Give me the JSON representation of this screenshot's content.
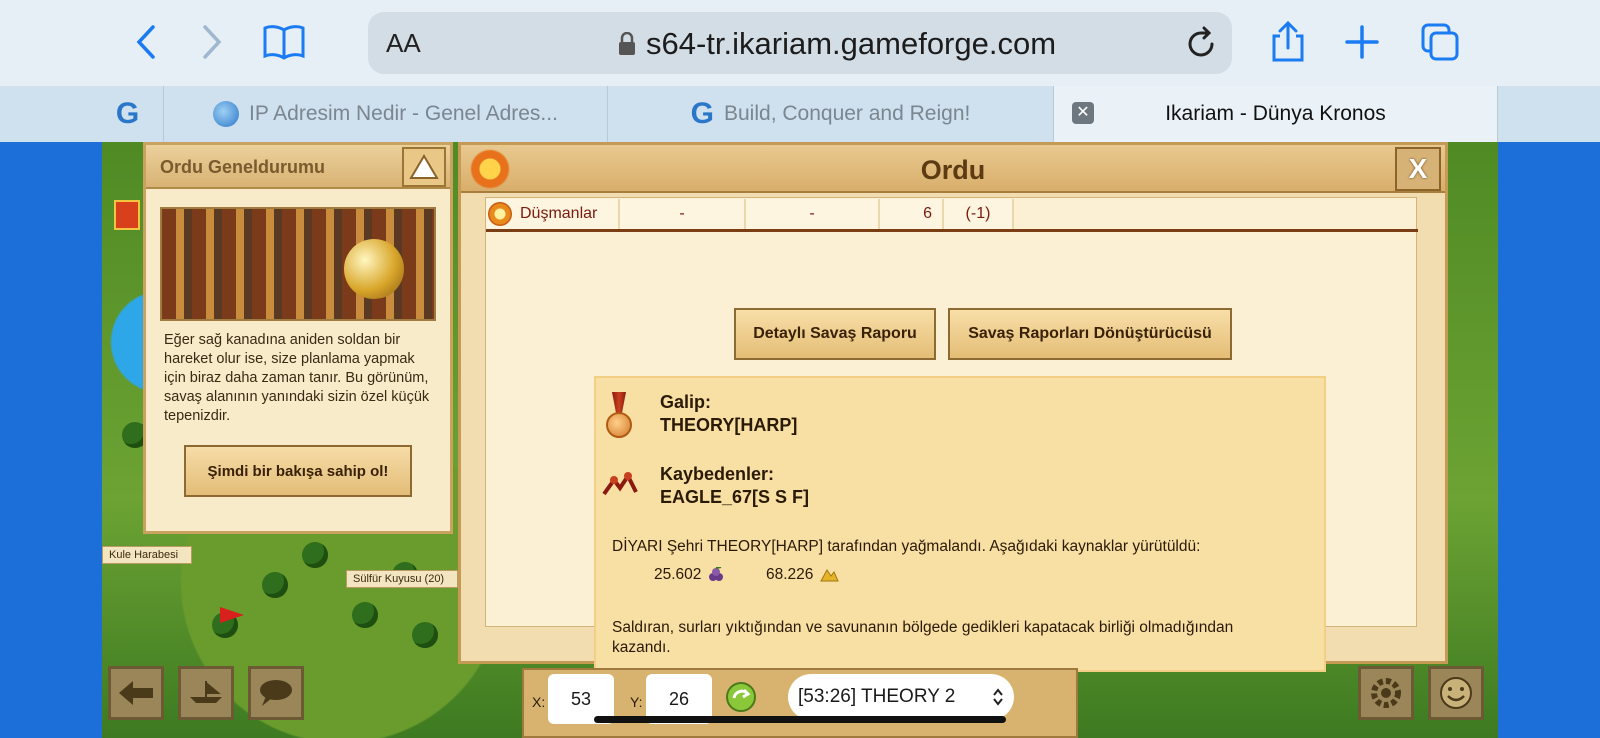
{
  "browser": {
    "address_size_label": "AA",
    "url": "s64-tr.ikariam.gameforge.com",
    "icons": [
      "back-icon",
      "forward-icon",
      "bookmarks-icon",
      "lock-icon",
      "reload-icon",
      "share-icon",
      "plus-icon",
      "tabs-icon"
    ],
    "tabs": [
      {
        "label": ""
      },
      {
        "label": "IP Adresim Nedir - Genel Adres..."
      },
      {
        "label": "Build, Conquer and Reign!"
      },
      {
        "label": "Ikariam - Dünya Kronos"
      }
    ]
  },
  "map": {
    "labels": [
      "Kule Harabesi",
      "Sülfür Kuyusu (20)"
    ]
  },
  "left_panel": {
    "title": "Ordu Geneldurumu",
    "text": "Eğer sağ kanadına aniden soldan bir hareket olur ise, size planlama yapmak için biraz daha zaman tanır. Bu görünüm, savaş alanının yanındaki sizin özel küçük tepenizdir.",
    "button": "Şimdi bir bakışa sahip ol!"
  },
  "main_window": {
    "title": "Ordu",
    "close": "X",
    "enemy_row": {
      "label": "Düşmanlar",
      "cells": [
        "-",
        "-",
        "6",
        "(-1)"
      ]
    },
    "buttons": {
      "detailed_report": "Detaylı Savaş Raporu",
      "converter": "Savaş Raporları Dönüştürücüsü"
    },
    "result": {
      "winner_label": "Galip:",
      "winner": "THEORY[HARP]",
      "losers_label": "Kaybedenler:",
      "losers": "EAGLE_67[S S F]",
      "loot_text": "DİYARI Şehri THEORY[HARP] tarafından yağmalandı. Aşağıdaki kaynaklar yürütüldü:",
      "resources": [
        {
          "amount": "25.602",
          "icon": "wine-icon"
        },
        {
          "amount": "68.226",
          "icon": "sulfur-icon"
        }
      ],
      "reason": "Saldıran, surları yıktığından ve savunanın bölgede gedikleri kapatacak birliği olmadığından kazandı."
    }
  },
  "bottom_bar": {
    "x_label": "X:",
    "x_value": "53",
    "y_label": "Y:",
    "y_value": "26",
    "island": "[53:26] THEORY 2"
  },
  "colors": {
    "safari_blue": "#1a7bf2",
    "panel_bg": "#f7ebc9",
    "sea": "#1c6fd8",
    "enemy_text": "#7a1a10"
  }
}
